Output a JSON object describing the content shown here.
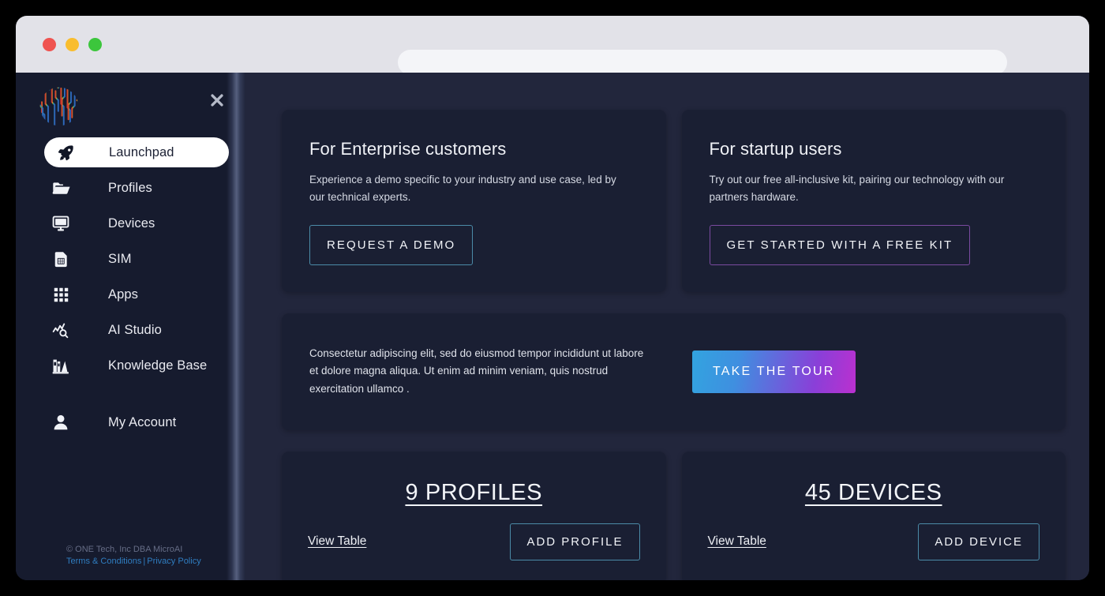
{
  "browser": {
    "url_value": "",
    "url_placeholder": "",
    "traffic_lights": [
      "close",
      "minimize",
      "maximize"
    ]
  },
  "sidebar": {
    "logo_alt": "MicroAI circuit logo",
    "close_label": "✕",
    "items": [
      {
        "label": "Launchpad",
        "icon": "rocket-icon",
        "active": true
      },
      {
        "label": "Profiles",
        "icon": "folder-icon",
        "active": false
      },
      {
        "label": "Devices",
        "icon": "monitor-icon",
        "active": false
      },
      {
        "label": "SIM",
        "icon": "sim-card-icon",
        "active": false
      },
      {
        "label": "Apps",
        "icon": "grid-icon",
        "active": false
      },
      {
        "label": "AI Studio",
        "icon": "chart-search-icon",
        "active": false
      },
      {
        "label": "Knowledge Base",
        "icon": "books-icon",
        "active": false
      }
    ],
    "account": {
      "label": "My Account",
      "icon": "user-icon"
    },
    "footer": {
      "copyright": "© ONE Tech, Inc DBA MicroAI",
      "terms": "Terms & Conditions",
      "separator": "|",
      "privacy": "Privacy Policy"
    }
  },
  "main": {
    "promos": [
      {
        "title": "For Enterprise customers",
        "description": "Experience a demo specific to your industry and use case, led by our technical experts.",
        "button": "REQUEST A DEMO",
        "accent": "#4b8ba8"
      },
      {
        "title": "For startup users",
        "description": "Try out our free all-inclusive kit, pairing our technology with our partners hardware.",
        "button": "GET STARTED WITH A FREE KIT",
        "accent": "#7a4aa0"
      }
    ],
    "tour": {
      "text": "Consectetur adipiscing elit, sed do eiusmod tempor incididunt ut labore et dolore magna aliqua. Ut enim ad minim veniam, quis nostrud exercitation ullamco .",
      "button": "TAKE THE TOUR",
      "gradient_from": "#32a4e0",
      "gradient_to": "#bb30cf"
    },
    "stats": [
      {
        "count": "9",
        "noun": "PROFILES",
        "title": "9 PROFILES",
        "view_link": "View Table",
        "add_button": "ADD PROFILE"
      },
      {
        "count": "45",
        "noun": "DEVICES",
        "title": "45 DEVICES",
        "view_link": "View Table",
        "add_button": "ADD DEVICE"
      }
    ]
  },
  "colors": {
    "app_background": "#22263c",
    "sidebar_background": "#161b2e",
    "card_background": "#1a1f33",
    "chrome_background": "#e2e2e8",
    "accent_teal": "#4b8ba8",
    "accent_purple": "#7a4aa0",
    "link_blue": "#2f7dc0"
  }
}
